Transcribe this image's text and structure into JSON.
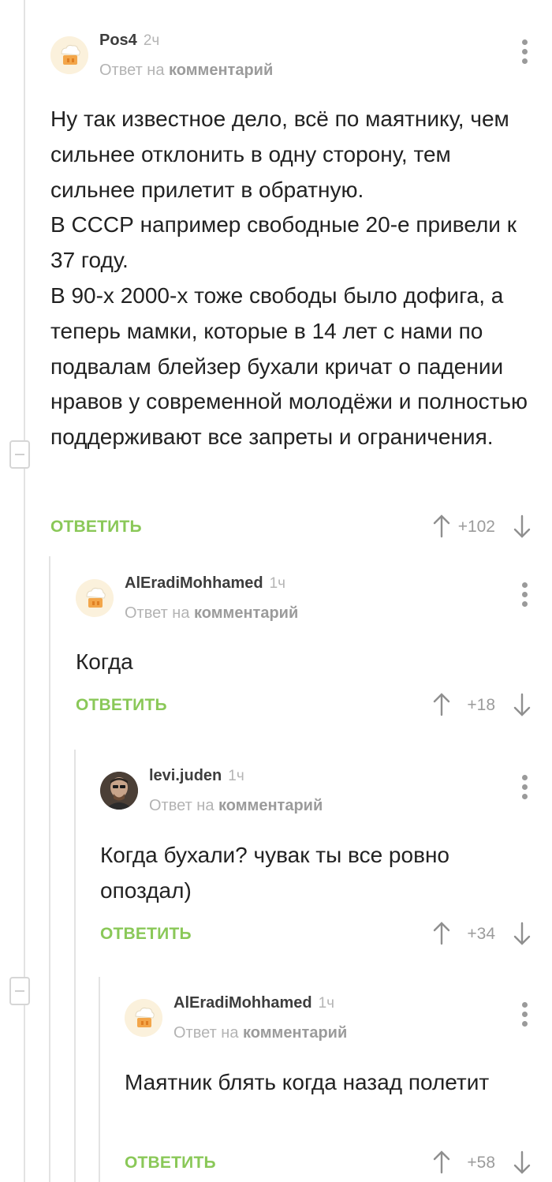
{
  "comments": [
    {
      "username": "Pos4",
      "time": "2ч",
      "reply_prefix": "Ответ на",
      "reply_target": "комментарий",
      "avatar_icon": "chef-hat-avatar-icon",
      "text": "Ну так известное дело, всё по маятнику, чем сильнее отклонить в одну сторону, тем сильнее прилетит в обратную.\nВ СССР например свободные 20-е привели к 37 году.\nВ 90-х 2000-х тоже свободы было дофига, а теперь мамки, которые в 14 лет с нами по подвалам блейзер бухали кричат о падении нравов у современной молодёжи и полностью поддерживают все запреты и ограничения.",
      "reply_label": "ОТВЕТИТЬ",
      "rating": "+102"
    },
    {
      "username": "AlEradiMohhamed",
      "time": "1ч",
      "reply_prefix": "Ответ на",
      "reply_target": "комментарий",
      "avatar_icon": "chef-hat-avatar-icon",
      "text": "Когда",
      "reply_label": "ОТВЕТИТЬ",
      "rating": "+18"
    },
    {
      "username": "levi.juden",
      "time": "1ч",
      "reply_prefix": "Ответ на",
      "reply_target": "комментарий",
      "avatar_icon": "user-photo-avatar-icon",
      "text": "Когда бухали? чувак ты все ровно опоздал)",
      "reply_label": "ОТВЕТИТЬ",
      "rating": "+34"
    },
    {
      "username": "AlEradiMohhamed",
      "time": "1ч",
      "reply_prefix": "Ответ на",
      "reply_target": "комментарий",
      "avatar_icon": "chef-hat-avatar-icon",
      "text": "Маятник блять когда назад полетит",
      "reply_label": "ОТВЕТИТЬ",
      "rating": "+58"
    }
  ],
  "colors": {
    "accent": "#8ac858",
    "meta": "#b3b3b3",
    "text": "#222222",
    "thread_line": "#e3e3e3"
  }
}
